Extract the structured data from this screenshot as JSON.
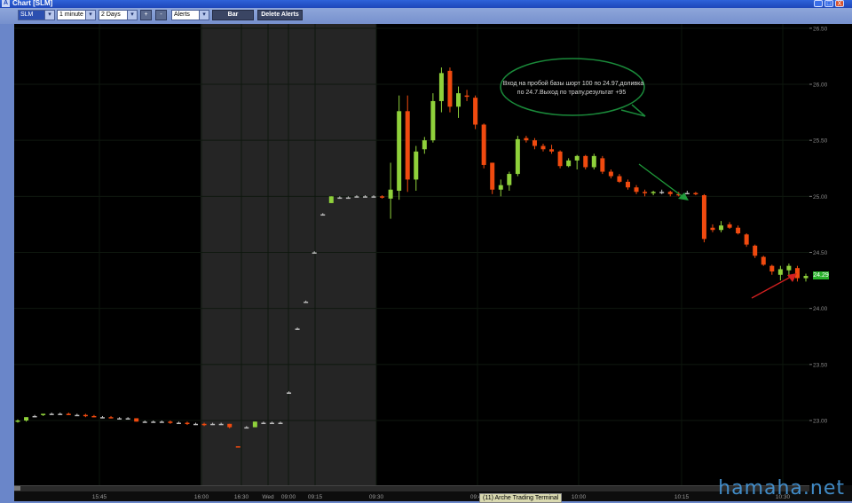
{
  "window": {
    "title": "Chart [SLM]",
    "controls": [
      "_",
      "□",
      "X"
    ]
  },
  "toolbar": {
    "symbol": "SLM",
    "interval": "1 minute",
    "range": "2 Days",
    "zoom_in": "+",
    "zoom_out": "-",
    "alerts": "Alerts",
    "bar_button": "Bar",
    "delete_alerts_button": "Delete Alerts"
  },
  "annotation": {
    "text_line1": "Вход на пробой базы шорт 100 по 24.97,доливка",
    "text_line2": "по 24.7.Выход по трапу,результат +95"
  },
  "status_tag": "(11) Arche Trading Terminal",
  "watermark": "hamaha.net",
  "current_price_label": "24.29",
  "colors": {
    "up": "#8fd13b",
    "down": "#f04a0f",
    "neutral": "#bbbbbb",
    "premarket_shade": "#252525",
    "bubble": "#1a8a3a",
    "grid": "#1e2a1e"
  },
  "chart_data": {
    "type": "candlestick",
    "y_ticks": [
      "26.50",
      "26.00",
      "25.50",
      "25.00",
      "24.50",
      "24.00",
      "23.50",
      "23.00"
    ],
    "ylim": [
      22.6,
      26.5
    ],
    "x_ticks": [
      "15:45",
      "16:00",
      "16:30",
      "Wed",
      "09:00",
      "09:15",
      "09:30",
      "09:45",
      "10:00",
      "10:15",
      "10:30"
    ],
    "candles": [
      {
        "o": 22.99,
        "h": 23.01,
        "l": 22.98,
        "c": 23.0
      },
      {
        "o": 23.0,
        "h": 23.03,
        "l": 22.99,
        "c": 23.03
      },
      {
        "o": 23.04,
        "h": 23.05,
        "l": 23.03,
        "c": 23.04
      },
      {
        "o": 23.05,
        "h": 23.06,
        "l": 23.04,
        "c": 23.06
      },
      {
        "o": 23.06,
        "h": 23.07,
        "l": 23.05,
        "c": 23.06
      },
      {
        "o": 23.06,
        "h": 23.07,
        "l": 23.05,
        "c": 23.06
      },
      {
        "o": 23.06,
        "h": 23.07,
        "l": 23.05,
        "c": 23.05
      },
      {
        "o": 23.05,
        "h": 23.06,
        "l": 23.04,
        "c": 23.05
      },
      {
        "o": 23.05,
        "h": 23.06,
        "l": 23.03,
        "c": 23.04
      },
      {
        "o": 23.04,
        "h": 23.05,
        "l": 23.03,
        "c": 23.03
      },
      {
        "o": 23.03,
        "h": 23.04,
        "l": 23.02,
        "c": 23.03
      },
      {
        "o": 23.03,
        "h": 23.04,
        "l": 23.02,
        "c": 23.02
      },
      {
        "o": 23.02,
        "h": 23.03,
        "l": 23.01,
        "c": 23.02
      },
      {
        "o": 23.02,
        "h": 23.03,
        "l": 23.01,
        "c": 23.02
      },
      {
        "o": 23.02,
        "h": 23.02,
        "l": 22.99,
        "c": 22.99
      },
      {
        "o": 22.99,
        "h": 23.0,
        "l": 22.98,
        "c": 22.99
      },
      {
        "o": 22.99,
        "h": 23.0,
        "l": 22.98,
        "c": 22.99
      },
      {
        "o": 22.99,
        "h": 23.0,
        "l": 22.98,
        "c": 22.99
      },
      {
        "o": 22.99,
        "h": 23.0,
        "l": 22.97,
        "c": 22.98
      },
      {
        "o": 22.98,
        "h": 22.99,
        "l": 22.97,
        "c": 22.98
      },
      {
        "o": 22.98,
        "h": 22.99,
        "l": 22.96,
        "c": 22.97
      },
      {
        "o": 22.97,
        "h": 22.98,
        "l": 22.96,
        "c": 22.97
      },
      {
        "o": 22.97,
        "h": 22.98,
        "l": 22.95,
        "c": 22.96
      },
      {
        "o": 22.97,
        "h": 22.98,
        "l": 22.96,
        "c": 22.97
      },
      {
        "o": 22.97,
        "h": 22.98,
        "l": 22.96,
        "c": 22.97
      },
      {
        "o": 22.97,
        "h": 22.97,
        "l": 22.93,
        "c": 22.94
      },
      {
        "o": 22.77,
        "h": 22.77,
        "l": 22.76,
        "c": 22.76
      },
      {
        "o": 22.94,
        "h": 22.95,
        "l": 22.93,
        "c": 22.94
      },
      {
        "o": 22.94,
        "h": 22.99,
        "l": 22.94,
        "c": 22.99
      },
      {
        "o": 22.98,
        "h": 22.99,
        "l": 22.97,
        "c": 22.98
      },
      {
        "o": 22.98,
        "h": 22.99,
        "l": 22.97,
        "c": 22.98
      },
      {
        "o": 22.98,
        "h": 22.99,
        "l": 22.97,
        "c": 22.98
      },
      {
        "o": 23.25,
        "h": 23.26,
        "l": 23.24,
        "c": 23.25
      },
      {
        "o": 23.82,
        "h": 23.83,
        "l": 23.81,
        "c": 23.82
      },
      {
        "o": 24.06,
        "h": 24.07,
        "l": 24.05,
        "c": 24.06
      },
      {
        "o": 24.5,
        "h": 24.51,
        "l": 24.49,
        "c": 24.5
      },
      {
        "o": 24.84,
        "h": 24.85,
        "l": 24.83,
        "c": 24.84
      },
      {
        "o": 24.94,
        "h": 25.0,
        "l": 24.94,
        "c": 25.0
      },
      {
        "o": 24.99,
        "h": 25.0,
        "l": 24.98,
        "c": 24.99
      },
      {
        "o": 24.99,
        "h": 25.0,
        "l": 24.98,
        "c": 24.99
      },
      {
        "o": 25.0,
        "h": 25.01,
        "l": 24.99,
        "c": 25.0
      },
      {
        "o": 25.0,
        "h": 25.01,
        "l": 24.99,
        "c": 25.0
      },
      {
        "o": 25.0,
        "h": 25.01,
        "l": 24.99,
        "c": 25.0
      },
      {
        "o": 25.0,
        "h": 25.01,
        "l": 24.98,
        "c": 24.99
      },
      {
        "o": 24.98,
        "h": 25.3,
        "l": 24.8,
        "c": 25.06
      },
      {
        "o": 25.05,
        "h": 25.9,
        "l": 24.97,
        "c": 25.76
      },
      {
        "o": 25.76,
        "h": 25.9,
        "l": 25.04,
        "c": 25.15
      },
      {
        "o": 25.15,
        "h": 25.45,
        "l": 25.05,
        "c": 25.4
      },
      {
        "o": 25.42,
        "h": 25.53,
        "l": 25.38,
        "c": 25.5
      },
      {
        "o": 25.5,
        "h": 25.92,
        "l": 25.48,
        "c": 25.85
      },
      {
        "o": 25.85,
        "h": 26.15,
        "l": 25.75,
        "c": 26.1
      },
      {
        "o": 26.12,
        "h": 26.15,
        "l": 25.75,
        "c": 25.8
      },
      {
        "o": 25.8,
        "h": 25.98,
        "l": 25.7,
        "c": 25.92
      },
      {
        "o": 25.9,
        "h": 25.95,
        "l": 25.85,
        "c": 25.89
      },
      {
        "o": 25.88,
        "h": 25.9,
        "l": 25.6,
        "c": 25.64
      },
      {
        "o": 25.64,
        "h": 25.65,
        "l": 25.25,
        "c": 25.28
      },
      {
        "o": 25.3,
        "h": 25.3,
        "l": 25.02,
        "c": 25.06
      },
      {
        "o": 25.06,
        "h": 25.15,
        "l": 25.0,
        "c": 25.1
      },
      {
        "o": 25.1,
        "h": 25.22,
        "l": 25.05,
        "c": 25.2
      },
      {
        "o": 25.2,
        "h": 25.54,
        "l": 25.18,
        "c": 25.51
      },
      {
        "o": 25.52,
        "h": 25.54,
        "l": 25.48,
        "c": 25.5
      },
      {
        "o": 25.5,
        "h": 25.52,
        "l": 25.42,
        "c": 25.45
      },
      {
        "o": 25.45,
        "h": 25.47,
        "l": 25.4,
        "c": 25.42
      },
      {
        "o": 25.42,
        "h": 25.46,
        "l": 25.38,
        "c": 25.4
      },
      {
        "o": 25.4,
        "h": 25.41,
        "l": 25.25,
        "c": 25.27
      },
      {
        "o": 25.27,
        "h": 25.34,
        "l": 25.26,
        "c": 25.32
      },
      {
        "o": 25.32,
        "h": 25.37,
        "l": 25.24,
        "c": 25.36
      },
      {
        "o": 25.36,
        "h": 25.37,
        "l": 25.24,
        "c": 25.26
      },
      {
        "o": 25.26,
        "h": 25.38,
        "l": 25.24,
        "c": 25.36
      },
      {
        "o": 25.34,
        "h": 25.36,
        "l": 25.2,
        "c": 25.22
      },
      {
        "o": 25.22,
        "h": 25.24,
        "l": 25.16,
        "c": 25.18
      },
      {
        "o": 25.18,
        "h": 25.2,
        "l": 25.12,
        "c": 25.13
      },
      {
        "o": 25.13,
        "h": 25.15,
        "l": 25.06,
        "c": 25.08
      },
      {
        "o": 25.08,
        "h": 25.1,
        "l": 25.02,
        "c": 25.04
      },
      {
        "o": 25.04,
        "h": 25.06,
        "l": 25.0,
        "c": 25.03
      },
      {
        "o": 25.03,
        "h": 25.05,
        "l": 25.01,
        "c": 25.04
      },
      {
        "o": 25.04,
        "h": 25.06,
        "l": 25.02,
        "c": 25.04
      },
      {
        "o": 25.04,
        "h": 25.05,
        "l": 25.0,
        "c": 25.02
      },
      {
        "o": 25.02,
        "h": 25.04,
        "l": 25.0,
        "c": 25.01
      },
      {
        "o": 25.03,
        "h": 25.05,
        "l": 25.02,
        "c": 25.03
      },
      {
        "o": 25.03,
        "h": 25.04,
        "l": 25.01,
        "c": 25.02
      },
      {
        "o": 25.01,
        "h": 25.02,
        "l": 24.59,
        "c": 24.62
      },
      {
        "o": 24.72,
        "h": 24.75,
        "l": 24.68,
        "c": 24.7
      },
      {
        "o": 24.7,
        "h": 24.78,
        "l": 24.68,
        "c": 24.74
      },
      {
        "o": 24.75,
        "h": 24.77,
        "l": 24.71,
        "c": 24.72
      },
      {
        "o": 24.72,
        "h": 24.74,
        "l": 24.66,
        "c": 24.67
      },
      {
        "o": 24.66,
        "h": 24.67,
        "l": 24.55,
        "c": 24.57
      },
      {
        "o": 24.56,
        "h": 24.57,
        "l": 24.45,
        "c": 24.47
      },
      {
        "o": 24.46,
        "h": 24.47,
        "l": 24.38,
        "c": 24.39
      },
      {
        "o": 24.38,
        "h": 24.39,
        "l": 24.3,
        "c": 24.33
      },
      {
        "o": 24.3,
        "h": 24.38,
        "l": 24.25,
        "c": 24.35
      },
      {
        "o": 24.34,
        "h": 24.4,
        "l": 24.28,
        "c": 24.38
      },
      {
        "o": 24.36,
        "h": 24.38,
        "l": 24.24,
        "c": 24.27
      },
      {
        "o": 24.27,
        "h": 24.31,
        "l": 24.24,
        "c": 24.29
      }
    ]
  }
}
